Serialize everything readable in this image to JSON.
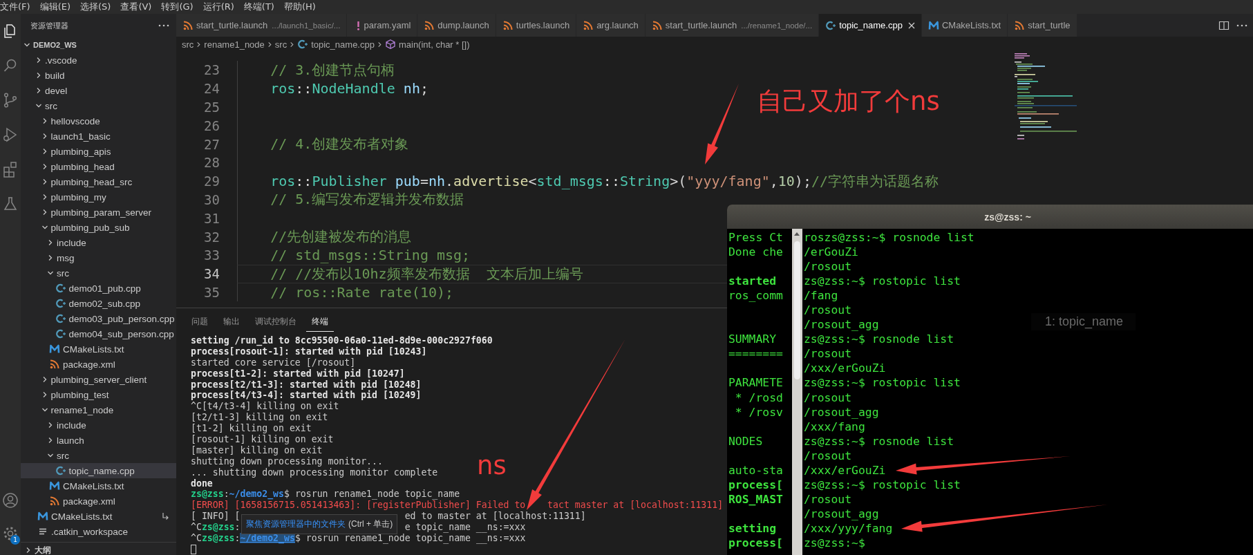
{
  "menu": [
    "文件(F)",
    "编辑(E)",
    "选择(S)",
    "查看(V)",
    "转到(G)",
    "运行(R)",
    "终端(T)",
    "帮助(H)"
  ],
  "activity_badge": "1",
  "sidebar": {
    "title": "资源管理器",
    "root": {
      "label": "DEMO2_WS",
      "expanded": true,
      "children": [
        {
          "label": ".vscode",
          "kind": "folder",
          "expanded": false,
          "selected": false
        },
        {
          "label": "build",
          "kind": "folder",
          "expanded": false,
          "selected": false
        },
        {
          "label": "devel",
          "kind": "folder",
          "expanded": false,
          "selected": false
        },
        {
          "label": "src",
          "kind": "folder",
          "expanded": true,
          "selected": false,
          "children": [
            {
              "label": "hellovscode",
              "kind": "folder",
              "expanded": false,
              "selected": false
            },
            {
              "label": "launch1_basic",
              "kind": "folder",
              "expanded": false,
              "selected": false
            },
            {
              "label": "plumbing_apis",
              "kind": "folder",
              "expanded": false,
              "selected": false
            },
            {
              "label": "plumbing_head",
              "kind": "folder",
              "expanded": false,
              "selected": false
            },
            {
              "label": "plumbing_head_src",
              "kind": "folder",
              "expanded": false,
              "selected": false
            },
            {
              "label": "plumbing_my",
              "kind": "folder",
              "expanded": false,
              "selected": false
            },
            {
              "label": "plumbing_param_server",
              "kind": "folder",
              "expanded": false,
              "selected": false
            },
            {
              "label": "plumbing_pub_sub",
              "kind": "folder",
              "expanded": true,
              "selected": false,
              "children": [
                {
                  "label": "include",
                  "kind": "folder",
                  "expanded": false,
                  "selected": false
                },
                {
                  "label": "msg",
                  "kind": "folder",
                  "expanded": false,
                  "selected": false
                },
                {
                  "label": "src",
                  "kind": "folder",
                  "expanded": true,
                  "selected": false,
                  "children": [
                    {
                      "label": "demo01_pub.cpp",
                      "kind": "cpp",
                      "selected": false
                    },
                    {
                      "label": "demo02_sub.cpp",
                      "kind": "cpp",
                      "selected": false
                    },
                    {
                      "label": "demo03_pub_person.cpp",
                      "kind": "cpp",
                      "selected": false
                    },
                    {
                      "label": "demo04_sub_person.cpp",
                      "kind": "cpp",
                      "selected": false
                    }
                  ]
                },
                {
                  "label": "CMakeLists.txt",
                  "kind": "cmake",
                  "selected": false
                },
                {
                  "label": "package.xml",
                  "kind": "xml",
                  "selected": false
                }
              ]
            },
            {
              "label": "plumbing_server_client",
              "kind": "folder",
              "expanded": false,
              "selected": false
            },
            {
              "label": "plumbing_test",
              "kind": "folder",
              "expanded": false,
              "selected": false
            },
            {
              "label": "rename1_node",
              "kind": "folder",
              "expanded": true,
              "selected": false,
              "children": [
                {
                  "label": "include",
                  "kind": "folder",
                  "expanded": false,
                  "selected": false
                },
                {
                  "label": "launch",
                  "kind": "folder",
                  "expanded": false,
                  "selected": false
                },
                {
                  "label": "src",
                  "kind": "folder",
                  "expanded": true,
                  "selected": false,
                  "children": [
                    {
                      "label": "topic_name.cpp",
                      "kind": "cpp",
                      "selected": true
                    }
                  ]
                },
                {
                  "label": "CMakeLists.txt",
                  "kind": "cmake",
                  "selected": false
                },
                {
                  "label": "package.xml",
                  "kind": "xml",
                  "selected": false
                }
              ]
            }
          ]
        },
        {
          "label": "CMakeLists.txt",
          "kind": "cmake-link",
          "selected": false
        },
        {
          "label": ".catkin_workspace",
          "kind": "text",
          "selected": false
        }
      ]
    },
    "outline": {
      "label": "大纲",
      "expanded": false
    }
  },
  "tabs": [
    {
      "label": "start_turtle.launch",
      "description": ".../launch1_basic/...",
      "kind": "launch",
      "selected": false
    },
    {
      "label": "param.yaml",
      "kind": "yaml",
      "selected": false
    },
    {
      "label": "dump.launch",
      "kind": "launch",
      "selected": false
    },
    {
      "label": "turtles.launch",
      "kind": "launch",
      "selected": false
    },
    {
      "label": "arg.launch",
      "kind": "launch",
      "selected": false
    },
    {
      "label": "start_turtle.launch",
      "description": ".../rename1_node/...",
      "kind": "launch",
      "selected": false
    },
    {
      "label": "topic_name.cpp",
      "kind": "cpp",
      "selected": true
    },
    {
      "label": "CMakeLists.txt",
      "kind": "cmake",
      "selected": false
    },
    {
      "label": "start_turtle",
      "kind": "launch",
      "selected": false
    }
  ],
  "breadcrumb": [
    {
      "text": "src",
      "kind": "folder"
    },
    {
      "text": "rename1_node",
      "kind": "folder"
    },
    {
      "text": "src",
      "kind": "folder"
    },
    {
      "text": "topic_name.cpp",
      "kind": "cpp"
    },
    {
      "text": "main(int, char * [])",
      "kind": "symbol"
    }
  ],
  "editor": {
    "lines": [
      {
        "number": "23",
        "current": false,
        "tokens": [
          {
            "kind": "comment",
            "text": "// 3.创建节点句柄"
          }
        ]
      },
      {
        "number": "24",
        "current": false,
        "tokens": [
          {
            "kind": "ns",
            "text": "ros"
          },
          {
            "kind": "punct",
            "text": "::"
          },
          {
            "kind": "type",
            "text": "NodeHandle"
          },
          {
            "kind": "var",
            "text": " nh"
          },
          {
            "kind": "punct",
            "text": ";"
          }
        ]
      },
      {
        "number": "25",
        "current": false
      },
      {
        "number": "26",
        "current": false
      },
      {
        "number": "27",
        "current": false,
        "tokens": [
          {
            "kind": "comment",
            "text": "// 4.创建发布者对象"
          }
        ]
      },
      {
        "number": "28",
        "current": false
      },
      {
        "number": "29",
        "current": false,
        "tokens": [
          {
            "kind": "ns",
            "text": "ros"
          },
          {
            "kind": "punct",
            "text": "::"
          },
          {
            "kind": "type",
            "text": "Publisher"
          },
          {
            "kind": "var",
            "text": " pub"
          },
          {
            "kind": "punct",
            "text": "="
          },
          {
            "kind": "var",
            "text": "nh"
          },
          {
            "kind": "punct",
            "text": "."
          },
          {
            "kind": "fn",
            "text": "advertise"
          },
          {
            "kind": "punct",
            "text": "<"
          },
          {
            "kind": "type",
            "text": "std_msgs"
          },
          {
            "kind": "punct",
            "text": "::"
          },
          {
            "kind": "type",
            "text": "String"
          },
          {
            "kind": "punct",
            "text": ">("
          },
          {
            "kind": "string",
            "text": "\"yyy/fang\""
          },
          {
            "kind": "punct",
            "text": ","
          },
          {
            "kind": "num",
            "text": "10"
          },
          {
            "kind": "punct",
            "text": ");"
          },
          {
            "kind": "comment",
            "text": "//字符串为话题名称"
          }
        ]
      },
      {
        "number": "30",
        "current": false,
        "tokens": [
          {
            "kind": "comment",
            "text": "// 5.编写发布逻辑并发布数据"
          }
        ]
      },
      {
        "number": "31",
        "current": false
      },
      {
        "number": "32",
        "current": false,
        "tokens": [
          {
            "kind": "comment",
            "text": "//先创建被发布的消息"
          }
        ]
      },
      {
        "number": "33",
        "current": false,
        "tokens": [
          {
            "kind": "comment",
            "text": "// std_msgs::String msg;"
          }
        ]
      },
      {
        "number": "34",
        "current": true,
        "tokens": [
          {
            "kind": "comment",
            "text": "// //发布以10hz频率发布数据  文本后加上编号"
          }
        ]
      },
      {
        "number": "35",
        "current": false,
        "tokens": [
          {
            "kind": "comment",
            "text": "// ros::Rate rate(10);"
          }
        ]
      }
    ]
  },
  "panel": {
    "tabs": [
      {
        "label": "问题",
        "selected": false
      },
      {
        "label": "输出",
        "selected": false
      },
      {
        "label": "调试控制台",
        "selected": false
      },
      {
        "label": "终端",
        "selected": true
      }
    ],
    "terminal_lines": [
      [
        {
          "kind": "bold",
          "text": "setting /run_id to 8cc95500-06a0-11ed-8d9e-000c2927f060"
        }
      ],
      [
        {
          "kind": "bold",
          "text": "process[rosout-1]: started with pid [10243]"
        }
      ],
      [
        {
          "kind": "plain",
          "text": "started core service [/rosout]"
        }
      ],
      [
        {
          "kind": "bold",
          "text": "process[t1-2]: started with pid [10247]"
        }
      ],
      [
        {
          "kind": "bold",
          "text": "process[t2/t1-3]: started with pid [10248]"
        }
      ],
      [
        {
          "kind": "bold",
          "text": "process[t4/t3-4]: started with pid [10249]"
        }
      ],
      [
        {
          "kind": "plain",
          "text": "^C[t4/t3-4] killing on exit"
        }
      ],
      [
        {
          "kind": "plain",
          "text": "[t2/t1-3] killing on exit"
        }
      ],
      [
        {
          "kind": "plain",
          "text": "[t1-2] killing on exit"
        }
      ],
      [
        {
          "kind": "plain",
          "text": "[rosout-1] killing on exit"
        }
      ],
      [
        {
          "kind": "plain",
          "text": "[master] killing on exit"
        }
      ],
      [
        {
          "kind": "plain",
          "text": "shutting down processing monitor..."
        }
      ],
      [
        {
          "kind": "plain",
          "text": "... shutting down processing monitor complete"
        }
      ],
      [
        {
          "kind": "bold",
          "text": "done"
        }
      ],
      [
        {
          "kind": "user",
          "text": "zs@zss"
        },
        {
          "kind": "plain",
          "text": ":"
        },
        {
          "kind": "path",
          "text": "~/demo2_ws"
        },
        {
          "kind": "plain",
          "text": "$ rosrun rename1_node topic_name"
        }
      ],
      [
        {
          "kind": "error",
          "text": "[ERROR] [1658156715.051413463]: [registerPublisher] Failed to"
        },
        {
          "kind": "covered"
        },
        {
          "kind": "error",
          "text": "tact master at [localhost:11311]"
        }
      ],
      [
        {
          "kind": "plain",
          "text": "[ INFO] ["
        },
        {
          "kind": "covered"
        },
        {
          "kind": "plain",
          "text": "ed to master at [localhost:11311]"
        }
      ],
      [
        {
          "kind": "plain",
          "text": "^C"
        },
        {
          "kind": "user",
          "text": "zs@zss"
        },
        {
          "kind": "plain",
          "text": ":"
        },
        {
          "kind": "covered"
        },
        {
          "kind": "plain",
          "text": "e topic_name __ns:=xxx"
        }
      ],
      [
        {
          "kind": "plain",
          "text": "^C"
        },
        {
          "kind": "user",
          "text": "zs@zss"
        },
        {
          "kind": "plain",
          "text": ":"
        },
        {
          "kind": "path-hover",
          "text": "~/demo2_ws"
        },
        {
          "kind": "plain",
          "text": "$ rosrun rename1_node topic_name __ns:=xxx"
        }
      ],
      [
        {
          "kind": "cursor"
        }
      ]
    ]
  },
  "tooltip": {
    "link": "聚焦资源管理器中的文件夹",
    "hint": "(Ctrl + 单击)"
  },
  "terminal_window": {
    "title": "zs@zss: ~",
    "ghost_select": "1: topic_name",
    "rows": [
      {
        "left": {
          "text": "Press Ct",
          "bold": false
        },
        "right": "roszs@zss:~$ rosnode list"
      },
      {
        "left": {
          "text": "Done che",
          "bold": false
        },
        "right": "/erGouZi"
      },
      {
        "right": "/rosout"
      },
      {
        "left": {
          "text": "started",
          "bold": true
        },
        "right": "zs@zss:~$ rostopic list"
      },
      {
        "left": {
          "text": "ros_comm",
          "bold": false
        },
        "right": "/fang"
      },
      {
        "right": "/rosout"
      },
      {
        "right": "/rosout_agg"
      },
      {
        "left": {
          "text": "SUMMARY",
          "bold": false
        },
        "right": "zs@zss:~$ rosnode list"
      },
      {
        "left": {
          "text": "========",
          "bold": false
        },
        "right": "/rosout"
      },
      {
        "right": "/xxx/erGouZi"
      },
      {
        "left": {
          "text": "PARAMETE",
          "bold": false
        },
        "right": "zs@zss:~$ rostopic list"
      },
      {
        "left": {
          "text": " * /rosd",
          "bold": false
        },
        "right": "/rosout"
      },
      {
        "left": {
          "text": " * /rosv",
          "bold": false
        },
        "right": "/rosout_agg"
      },
      {
        "right": "/xxx/fang"
      },
      {
        "left": {
          "text": "NODES",
          "bold": false
        },
        "right": "zs@zss:~$ rosnode list"
      },
      {
        "right": "/rosout"
      },
      {
        "left": {
          "text": "auto-sta",
          "bold": false
        },
        "right": "/xxx/erGouZi"
      },
      {
        "left": {
          "text": "process[",
          "bold": true
        },
        "right": "zs@zss:~$ rostopic list"
      },
      {
        "left": {
          "text": "ROS_MAST",
          "bold": true
        },
        "right": "/rosout"
      },
      {
        "right": "/rosout_agg"
      },
      {
        "left": {
          "text": "setting",
          "bold": true
        },
        "right": "/xxx/yyy/fang"
      },
      {
        "left": {
          "text": "process[",
          "bold": true
        },
        "right": "zs@zss:~$"
      }
    ]
  },
  "annotations": [
    {
      "text": "自己又加了个ns"
    },
    {
      "text": "ns"
    }
  ]
}
